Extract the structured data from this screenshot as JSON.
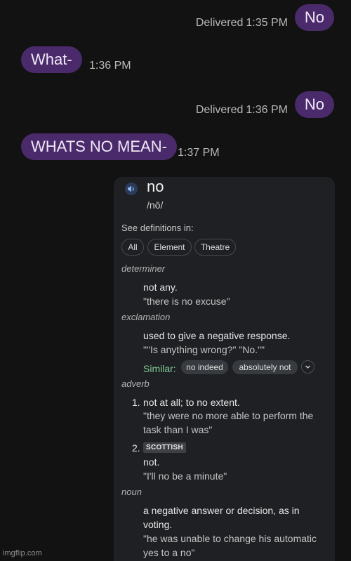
{
  "messages": [
    {
      "side": "sent",
      "text": "No",
      "status": "Delivered",
      "time": "1:35 PM"
    },
    {
      "side": "received",
      "text": "What-",
      "time": "1:36 PM"
    },
    {
      "side": "sent",
      "text": "No",
      "status": "Delivered",
      "time": "1:36 PM"
    },
    {
      "side": "received",
      "text": "WHATS NO MEAN-",
      "time": "1:37 PM"
    }
  ],
  "dictionary": {
    "speaker_icon": "speaker-icon",
    "word": "no",
    "phonetic": "/nō/",
    "see_definitions": "See definitions in:",
    "chips": [
      "All",
      "Element",
      "Theatre"
    ],
    "determiner": {
      "pos": "determiner",
      "definition": "not any.",
      "example": "\"there is no excuse\""
    },
    "exclamation": {
      "pos": "exclamation",
      "definition": "used to give a negative response.",
      "example": "\"\"Is anything wrong?\" \"No.\"\"",
      "similar_label": "Similar:",
      "similar": [
        "no indeed",
        "absolutely not"
      ]
    },
    "adverb": {
      "pos": "adverb",
      "senses": [
        {
          "num": "1.",
          "definition": "not at all; to no extent.",
          "example_line1": "\"they were no more able to perform the",
          "example_line2": "task than I was\""
        },
        {
          "num": "2.",
          "tag": "SCOTTISH",
          "definition": "not.",
          "example": "\"I'll no be a minute\""
        }
      ]
    },
    "noun": {
      "pos": "noun",
      "definition_line1": "a negative answer or decision, as in",
      "definition_line2": "voting.",
      "example_line1": "\"he was unable to change his automatic",
      "example_line2": "yes to a no\""
    }
  },
  "watermark": "imgflip.com",
  "colors": {
    "background": "#121212",
    "bubble": "#4a2a6a",
    "card": "#1e2023",
    "similar_green": "#81c995"
  }
}
